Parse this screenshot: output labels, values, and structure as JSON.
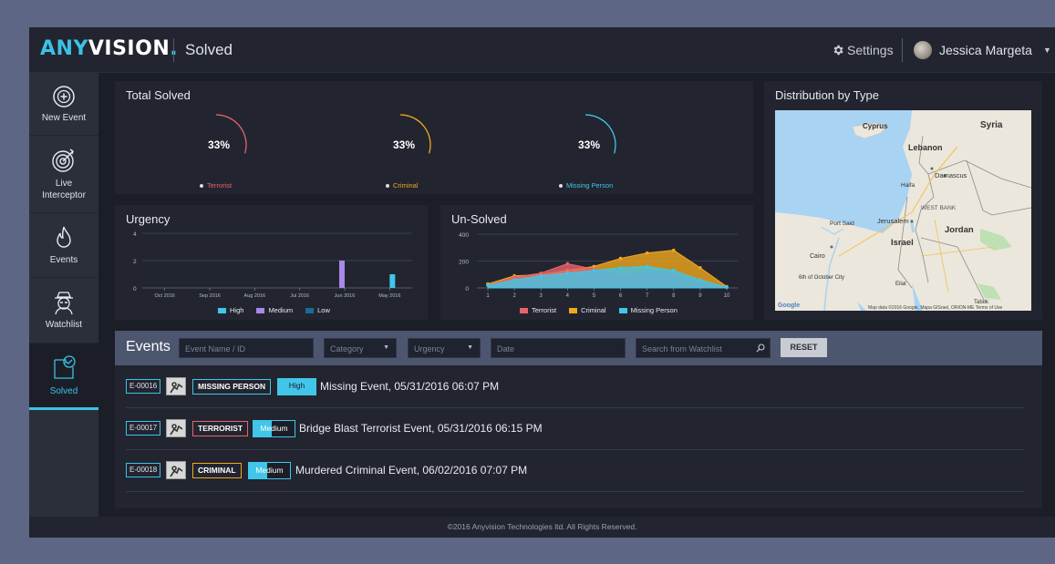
{
  "header": {
    "logo_main": "ANY",
    "logo_rest": "VISION",
    "logo_dot": ".",
    "page_title": "Solved",
    "settings_label": "Settings",
    "user_name": "Jessica Margeta"
  },
  "sidebar": {
    "items": [
      {
        "label": "New Event",
        "icon": "plus-circle-icon"
      },
      {
        "label": "Live Interceptor",
        "icon": "target-icon"
      },
      {
        "label": "Events",
        "icon": "flame-icon"
      },
      {
        "label": "Watchlist",
        "icon": "spy-icon"
      },
      {
        "label": "Solved",
        "icon": "solved-check-icon"
      }
    ]
  },
  "total_solved": {
    "title": "Total Solved",
    "gauges": [
      {
        "pct": "33%",
        "label": "Terrorist",
        "color": "#e8636b"
      },
      {
        "pct": "33%",
        "label": "Criminal",
        "color": "#f2a81d"
      },
      {
        "pct": "33%",
        "label": "Missing Person",
        "color": "#41c6ea"
      }
    ]
  },
  "urgency": {
    "title": "Urgency",
    "legend": [
      {
        "name": "High",
        "color": "#41c6ea"
      },
      {
        "name": "Medium",
        "color": "#a888e8"
      },
      {
        "name": "Low",
        "color": "#1c6a95"
      }
    ]
  },
  "unsolved": {
    "title": "Un-Solved",
    "legend": [
      {
        "name": "Terrorist",
        "color": "#e8636b"
      },
      {
        "name": "Criminal",
        "color": "#f2a81d"
      },
      {
        "name": "Missing Person",
        "color": "#41c6ea"
      }
    ]
  },
  "distribution": {
    "title": "Distribution by Type",
    "map_labels": [
      "Cyprus",
      "Syria",
      "Lebanon",
      "Damascus",
      "Haifa",
      "WEST BANK",
      "Jerusalem",
      "Jordan",
      "Israel",
      "Port Said",
      "Cairo",
      "6th of October City",
      "Eilat",
      "Tabuk"
    ],
    "attribution": "Map data ©2016 Google, Mapa GISrael, ORION-ME  Terms of Use",
    "google": "Google"
  },
  "events_filter": {
    "title": "Events",
    "name_placeholder": "Event Name / ID",
    "category": "Category",
    "urgency": "Urgency",
    "date": "Date",
    "watchlist_placeholder": "Search from Watchlist",
    "reset": "RESET"
  },
  "events": [
    {
      "id": "E-00016",
      "category": "MISSING PERSON",
      "cat_color": "#41c6ea",
      "urgency": "High",
      "text": "Missing Event, 05/31/2016 06:07 PM"
    },
    {
      "id": "E-00017",
      "category": "TERRORIST",
      "cat_color": "#e8636b",
      "urgency": "Medium",
      "text": "Bridge Blast Terrorist Event, 05/31/2016 06:15 PM"
    },
    {
      "id": "E-00018",
      "category": "CRIMINAL",
      "cat_color": "#f2a81d",
      "urgency": "Medium",
      "text": "Murdered Criminal Event, 06/02/2016 07:07 PM"
    }
  ],
  "footer": "©2016 Anyvision Technologies ltd. All Rights Reserved.",
  "chart_data": [
    {
      "type": "gauge",
      "title": "Total Solved",
      "categories": [
        "Terrorist",
        "Criminal",
        "Missing Person"
      ],
      "values": [
        33,
        33,
        33
      ]
    },
    {
      "type": "bar",
      "title": "Urgency",
      "categories": [
        "Oct 2016",
        "Sep 2016",
        "Aug 2016",
        "Jul 2016",
        "Jun 2016",
        "May 2016"
      ],
      "yticks": [
        0,
        2,
        4
      ],
      "ylim": [
        0,
        4
      ],
      "series": [
        {
          "name": "High",
          "values": [
            0,
            0,
            0,
            0,
            0,
            1
          ]
        },
        {
          "name": "Medium",
          "values": [
            0,
            0,
            0,
            0,
            2,
            0
          ]
        },
        {
          "name": "Low",
          "values": [
            0,
            0,
            0,
            0,
            0,
            0
          ]
        }
      ],
      "legend": "bottom"
    },
    {
      "type": "area",
      "title": "Un-Solved",
      "x": [
        1,
        2,
        3,
        4,
        5,
        6,
        7,
        8,
        9,
        10
      ],
      "yticks": [
        0,
        200,
        400
      ],
      "ylim": [
        0,
        400
      ],
      "series": [
        {
          "name": "Terrorist",
          "values": [
            20,
            80,
            110,
            180,
            140,
            100,
            120,
            110,
            40,
            5
          ]
        },
        {
          "name": "Criminal",
          "values": [
            30,
            90,
            100,
            130,
            160,
            220,
            260,
            280,
            150,
            10
          ]
        },
        {
          "name": "Missing Person",
          "values": [
            20,
            60,
            90,
            110,
            130,
            150,
            160,
            130,
            60,
            5
          ]
        }
      ],
      "legend": "bottom"
    }
  ]
}
